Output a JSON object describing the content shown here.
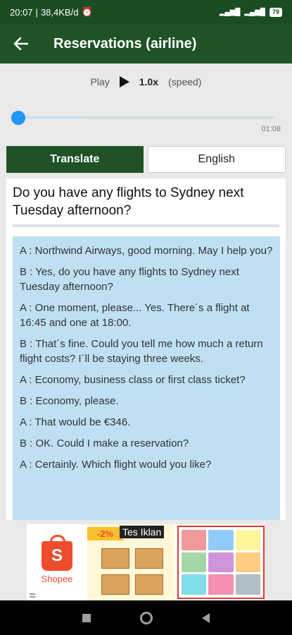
{
  "status_bar": {
    "time": "20:07",
    "network_speed": "38,4KB/d",
    "battery": "79"
  },
  "app_bar": {
    "title": "Reservations (airline)"
  },
  "player": {
    "play_label": "Play",
    "speed_value": "1.0x",
    "speed_label": "(speed)",
    "duration": "01:08",
    "progress_fraction": 0.0
  },
  "buttons": {
    "translate": "Translate",
    "english": "English"
  },
  "content": {
    "question": "Do you have any flights to Sydney next Tuesday afternoon?",
    "dialog": [
      "A : Northwind Airways, good morning. May I help you?",
      "B : Yes, do you have any flights to Sydney next Tuesday afternoon?",
      "A : One moment, please... Yes. There´s a flight at 16:45 and one at 18:00.",
      "B : That´s fine. Could you tell me how much a return flight costs? I´ll be staying three weeks.",
      "A : Economy, business class or first class ticket?",
      "B : Economy, please.",
      "A : That would be €346.",
      "B : OK. Could I make a reservation?",
      "A : Certainly. Which flight would you like?"
    ]
  },
  "ad": {
    "brand": "Shopee",
    "discount": "-2%",
    "tag": "Tes Iklan"
  },
  "colors": {
    "app_bar": "#1f5327",
    "accent": "#2196f3",
    "dialog_bg": "#bfe0f3",
    "shopee": "#ee4d2d"
  }
}
